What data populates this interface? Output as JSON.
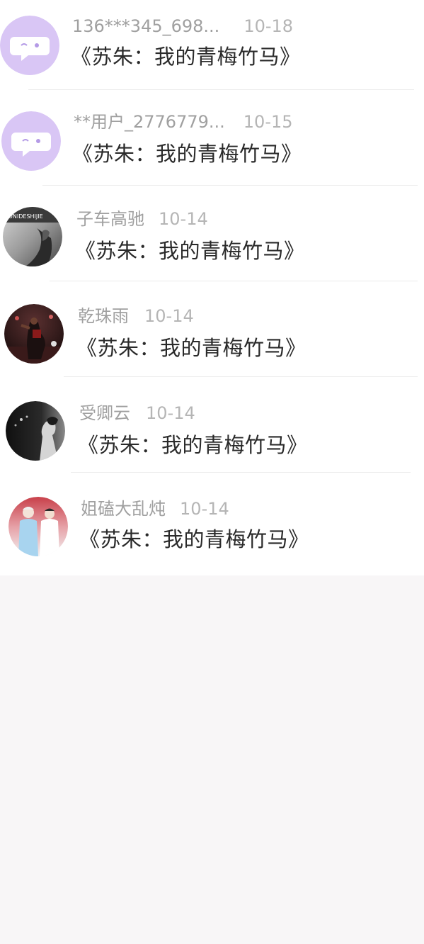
{
  "comments": [
    {
      "user": "136***345_698...",
      "date": "10-18",
      "book": "《苏朱：我的青梅竹马》",
      "avatar_icon": "default-chat-bubble-avatar"
    },
    {
      "user": "**用户_2776779...",
      "date": "10-15",
      "book": "《苏朱：我的青梅竹马》",
      "avatar_icon": "default-chat-bubble-avatar"
    },
    {
      "user": "子车高驰",
      "date": "10-14",
      "book": "《苏朱：我的青梅竹马》",
      "avatar_icon": "grayscale-photo-avatar"
    },
    {
      "user": "乾珠雨",
      "date": "10-14",
      "book": "《苏朱：我的青梅竹马》",
      "avatar_icon": "basketball-photo-avatar"
    },
    {
      "user": "受卿云",
      "date": "10-14",
      "book": "《苏朱：我的青梅竹马》",
      "avatar_icon": "dark-portrait-avatar"
    },
    {
      "user": "姐磕大乱炖",
      "date": "10-14",
      "book": "《苏朱：我的青梅竹马》",
      "avatar_icon": "stage-photo-avatar"
    }
  ],
  "colors": {
    "default_avatar_bg": "#d9c6f5",
    "text_primary": "#2a2a2a",
    "text_secondary": "#a0a0a0",
    "page_bg": "#f8f6f7"
  }
}
